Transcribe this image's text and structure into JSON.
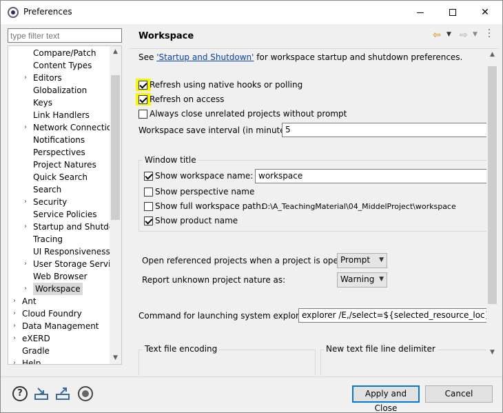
{
  "window": {
    "title": "Preferences"
  },
  "filter": {
    "placeholder": "type filter text"
  },
  "tree": {
    "items": [
      {
        "label": "Compare/Patch",
        "expandable": false,
        "level": 1
      },
      {
        "label": "Content Types",
        "expandable": false,
        "level": 1
      },
      {
        "label": "Editors",
        "expandable": true,
        "level": 1
      },
      {
        "label": "Globalization",
        "expandable": false,
        "level": 1
      },
      {
        "label": "Keys",
        "expandable": false,
        "level": 1
      },
      {
        "label": "Link Handlers",
        "expandable": false,
        "level": 1
      },
      {
        "label": "Network Connections",
        "expandable": true,
        "level": 1
      },
      {
        "label": "Notifications",
        "expandable": false,
        "level": 1
      },
      {
        "label": "Perspectives",
        "expandable": false,
        "level": 1
      },
      {
        "label": "Project Natures",
        "expandable": false,
        "level": 1
      },
      {
        "label": "Quick Search",
        "expandable": false,
        "level": 1
      },
      {
        "label": "Search",
        "expandable": false,
        "level": 1
      },
      {
        "label": "Security",
        "expandable": true,
        "level": 1
      },
      {
        "label": "Service Policies",
        "expandable": false,
        "level": 1
      },
      {
        "label": "Startup and Shutdown",
        "expandable": true,
        "level": 1
      },
      {
        "label": "Tracing",
        "expandable": false,
        "level": 1
      },
      {
        "label": "UI Responsiveness Monitoring",
        "expandable": false,
        "level": 1
      },
      {
        "label": "User Storage Service",
        "expandable": true,
        "level": 1
      },
      {
        "label": "Web Browser",
        "expandable": false,
        "level": 1
      },
      {
        "label": "Workspace",
        "expandable": true,
        "level": 1,
        "selected": true
      },
      {
        "label": "Ant",
        "expandable": true,
        "level": 0
      },
      {
        "label": "Cloud Foundry",
        "expandable": true,
        "level": 0
      },
      {
        "label": "Data Management",
        "expandable": true,
        "level": 0
      },
      {
        "label": "eXERD",
        "expandable": true,
        "level": 0
      },
      {
        "label": "Gradle",
        "expandable": false,
        "level": 0
      },
      {
        "label": "Help",
        "expandable": true,
        "level": 0
      }
    ]
  },
  "pane": {
    "title": "Workspace",
    "see_prefix": "See ",
    "see_link": "'Startup and Shutdown'",
    "see_suffix": " for workspace startup and shutdown preferences.",
    "refresh_native": "Refresh using native hooks or polling",
    "refresh_native_checked": true,
    "refresh_access": "Refresh on access",
    "refresh_access_checked": true,
    "always_close": "Always close unrelated projects without prompt",
    "always_close_checked": false,
    "save_interval_label": "Workspace save interval (in minutes):",
    "save_interval_value": "5",
    "window_title_group": "Window title",
    "show_ws_name": "Show workspace name:",
    "show_ws_name_checked": true,
    "ws_name_value": "workspace",
    "show_perspective": "Show perspective name",
    "show_perspective_checked": false,
    "show_full_path": "Show full workspace path:",
    "show_full_path_checked": false,
    "full_path_value": "D:\\A_TeachingMaterial\\04_MiddelProject\\workspace",
    "show_product": "Show product name",
    "show_product_checked": true,
    "open_ref_label": "Open referenced projects when a project is opened:",
    "open_ref_value": "Prompt",
    "report_unknown_label": "Report unknown project nature as:",
    "report_unknown_value": "Warning",
    "cmd_label": "Command for launching system explorer:",
    "cmd_value": "explorer /E,/select=${selected_resource_loc}",
    "text_encoding_group": "Text file encoding",
    "line_delim_group": "New text file line delimiter"
  },
  "buttons": {
    "apply_close": "Apply and Close",
    "cancel": "Cancel"
  },
  "icons": [
    "help-icon",
    "import-icon",
    "export-icon",
    "record-icon",
    "back-arrow-icon",
    "forward-arrow-icon",
    "view-menu-icon"
  ],
  "colors": {
    "highlight": "#f7f700",
    "link": "#0a3ea8",
    "default_button_border": "#0078d7"
  }
}
